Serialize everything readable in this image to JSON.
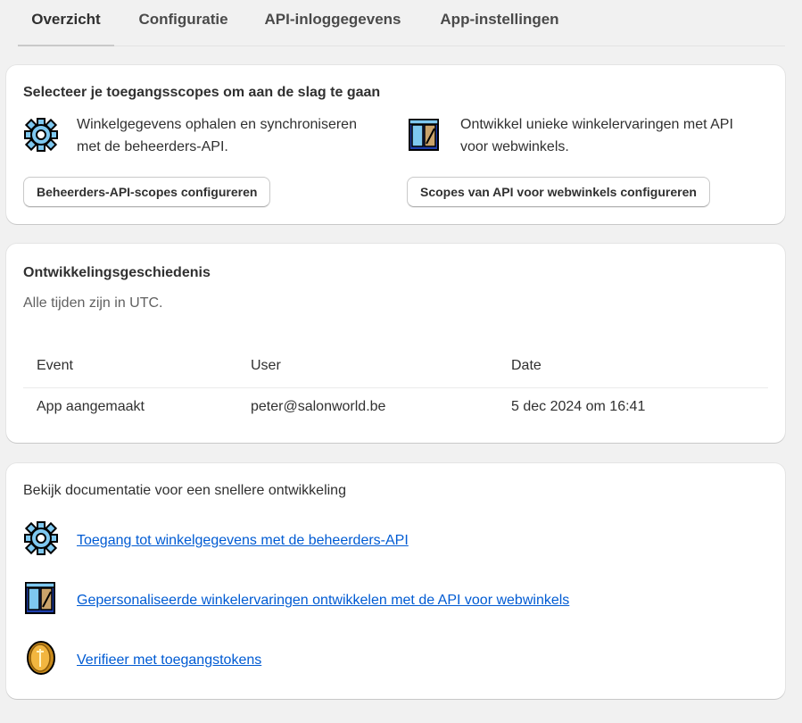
{
  "tabs": [
    {
      "label": "Overzicht",
      "active": true
    },
    {
      "label": "Configuratie",
      "active": false
    },
    {
      "label": "API-inloggegevens",
      "active": false
    },
    {
      "label": "App-instellingen",
      "active": false
    }
  ],
  "scopes_card": {
    "title": "Selecteer je toegangsscopes om aan de slag te gaan",
    "admin": {
      "icon": "gear-icon",
      "description_line1": "Winkelgegevens ophalen en synchroniseren",
      "description_line2": "met de beheerders-API.",
      "button_label": "Beheerders-API-scopes configureren"
    },
    "storefront": {
      "icon": "storefront-icon",
      "description_line1": "Ontwikkel unieke winkelervaringen met API",
      "description_line2": "voor webwinkels.",
      "button_label": "Scopes van API voor webwinkels configureren"
    }
  },
  "history_card": {
    "title": "Ontwikkelingsgeschiedenis",
    "subtitle": "Alle tijden zijn in UTC.",
    "columns": [
      "Event",
      "User",
      "Date"
    ],
    "rows": [
      [
        "App aangemaakt",
        "peter@salonworld.be",
        "5 dec 2024 om 16:41"
      ]
    ]
  },
  "docs_card": {
    "title": "Bekijk documentatie voor een snellere ontwikkeling",
    "links": [
      {
        "icon": "gear-icon",
        "label": "Toegang tot winkelgegevens met de beheerders-API"
      },
      {
        "icon": "storefront-icon",
        "label": "Gepersonaliseerde winkelervaringen ontwikkelen met de API voor webwinkels"
      },
      {
        "icon": "token-coin-icon",
        "label": "Verifieer met toegangstokens"
      }
    ]
  },
  "colors": {
    "background": "#f1f1f1",
    "card": "#ffffff",
    "link": "#005bd3",
    "text": "#303030"
  }
}
